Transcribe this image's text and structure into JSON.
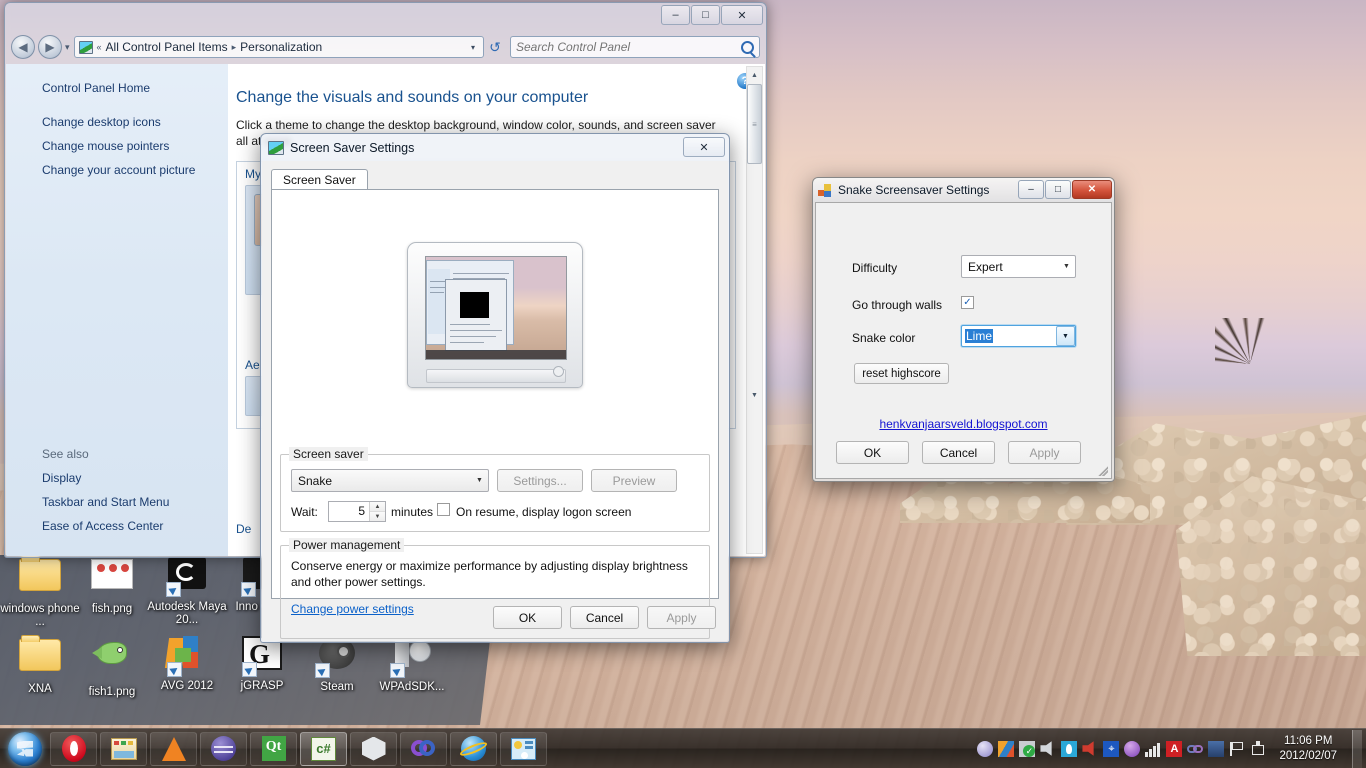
{
  "desktop": {
    "icons_row1": [
      {
        "label": "windows phone ...",
        "icon": "folder-icon"
      },
      {
        "label": "fish.png",
        "icon": "image-file-icon"
      },
      {
        "label": "Autodesk Maya 20...",
        "icon": "maya-shortcut-icon"
      },
      {
        "label": "Inno Cor...",
        "icon": "inno-setup-shortcut-icon"
      }
    ],
    "icons_row2": [
      {
        "label": "XNA",
        "icon": "folder-icon"
      },
      {
        "label": "fish1.png",
        "icon": "fish-image-icon"
      },
      {
        "label": "AVG 2012",
        "icon": "avg-shortcut-icon"
      },
      {
        "label": "jGRASP",
        "icon": "jgrasp-shortcut-icon"
      },
      {
        "label": "Steam",
        "icon": "steam-shortcut-icon"
      },
      {
        "label": "WPAdSDK...",
        "icon": "disc-shortcut-icon"
      }
    ]
  },
  "control_panel": {
    "window_buttons": {
      "minimize": "–",
      "maximize": "□",
      "close": "✕"
    },
    "nav": {
      "back": "◀",
      "forward": "▶",
      "history_chevron": "▾"
    },
    "breadcrumb": {
      "chevrons": "«",
      "items": [
        "All Control Panel Items",
        "Personalization"
      ],
      "separator": "▸",
      "dropdown": "▾"
    },
    "refresh_icon": "↺",
    "search": {
      "placeholder": "Search Control Panel",
      "value": "",
      "icon": "search-icon"
    },
    "sidebar": {
      "home": "Control Panel Home",
      "links": [
        "Change desktop icons",
        "Change mouse pointers",
        "Change your account picture"
      ],
      "see_also_label": "See also",
      "see_also": [
        "Display",
        "Taskbar and Start Menu",
        "Ease of Access Center"
      ]
    },
    "content": {
      "help_icon": "?",
      "title": "Change the visuals and sounds on your computer",
      "description": "Click a theme to change the desktop background, window color, sounds, and screen saver all at once.",
      "theme_group_label": "My",
      "aero_label": "Ae",
      "bottom_label": "De"
    },
    "scrollbar": {
      "up": "▲",
      "down": "▼",
      "grip": "≡"
    }
  },
  "screen_saver_dialog": {
    "title": "Screen Saver Settings",
    "icon": "display-icon",
    "close": "✕",
    "tab": "Screen Saver",
    "monitor_preview": "screensaver-preview-monitor",
    "group_screensaver": {
      "legend": "Screen saver",
      "selected": "Snake",
      "dropdown_arrow": "▼",
      "settings_button": "Settings...",
      "preview_button": "Preview",
      "wait_label": "Wait:",
      "wait_value": "5",
      "minutes_label": "minutes",
      "spin_up": "▲",
      "spin_down": "▼",
      "resume_checkbox_checked": false,
      "resume_label": "On resume, display logon screen"
    },
    "group_power": {
      "legend": "Power management",
      "text": "Conserve energy or maximize performance by adjusting display brightness and other power settings.",
      "link": "Change power settings"
    },
    "buttons": {
      "ok": "OK",
      "cancel": "Cancel",
      "apply": "Apply",
      "apply_disabled": true
    }
  },
  "snake_dialog": {
    "title": "Snake Screensaver Settings",
    "icon": "app-blocks-icon",
    "window_buttons": {
      "minimize": "–",
      "maximize": "□",
      "close": "✕"
    },
    "fields": {
      "difficulty_label": "Difficulty",
      "difficulty_value": "Expert",
      "difficulty_arrow": "▼",
      "walls_label": "Go through walls",
      "walls_checked": true,
      "walls_check_glyph": "✓",
      "color_label": "Snake color",
      "color_value": "Lime",
      "color_arrow": "▼"
    },
    "reset_button": "reset highscore",
    "link": "henkvanjaarsveld.blogspot.com",
    "buttons": {
      "ok": "OK",
      "cancel": "Cancel",
      "apply": "Apply",
      "apply_disabled": true
    }
  },
  "taskbar": {
    "start_button": "start-orb",
    "pinned": [
      {
        "name": "opera-icon"
      },
      {
        "name": "file-explorer-icon"
      },
      {
        "name": "vlc-icon"
      },
      {
        "name": "eclipse-icon"
      },
      {
        "name": "qt-creator-icon"
      },
      {
        "name": "visual-csharp-icon"
      },
      {
        "name": "unity-icon"
      },
      {
        "name": "visual-studio-icon"
      },
      {
        "name": "ie-icon"
      },
      {
        "name": "remote-desktop-icon"
      }
    ],
    "tray": [
      "action-center-icon",
      "avg-icon",
      "security-shield-icon",
      "volume-muted-icon",
      "wifi-icon",
      "speaker-icon",
      "bluetooth-icon",
      "bittorrent-icon",
      "signal-bars-icon",
      "adobe-icon",
      "link-icon",
      "nvidia-icon",
      "flag-icon",
      "safely-remove-icon"
    ],
    "clock_time": "11:06 PM",
    "clock_date": "2012/02/07"
  },
  "colors": {
    "aero_accent": "#19528f",
    "link": "#0b61c9",
    "selection": "#2a7fd4",
    "close_red": "#d4543c",
    "taskbar": "#2a2420"
  }
}
